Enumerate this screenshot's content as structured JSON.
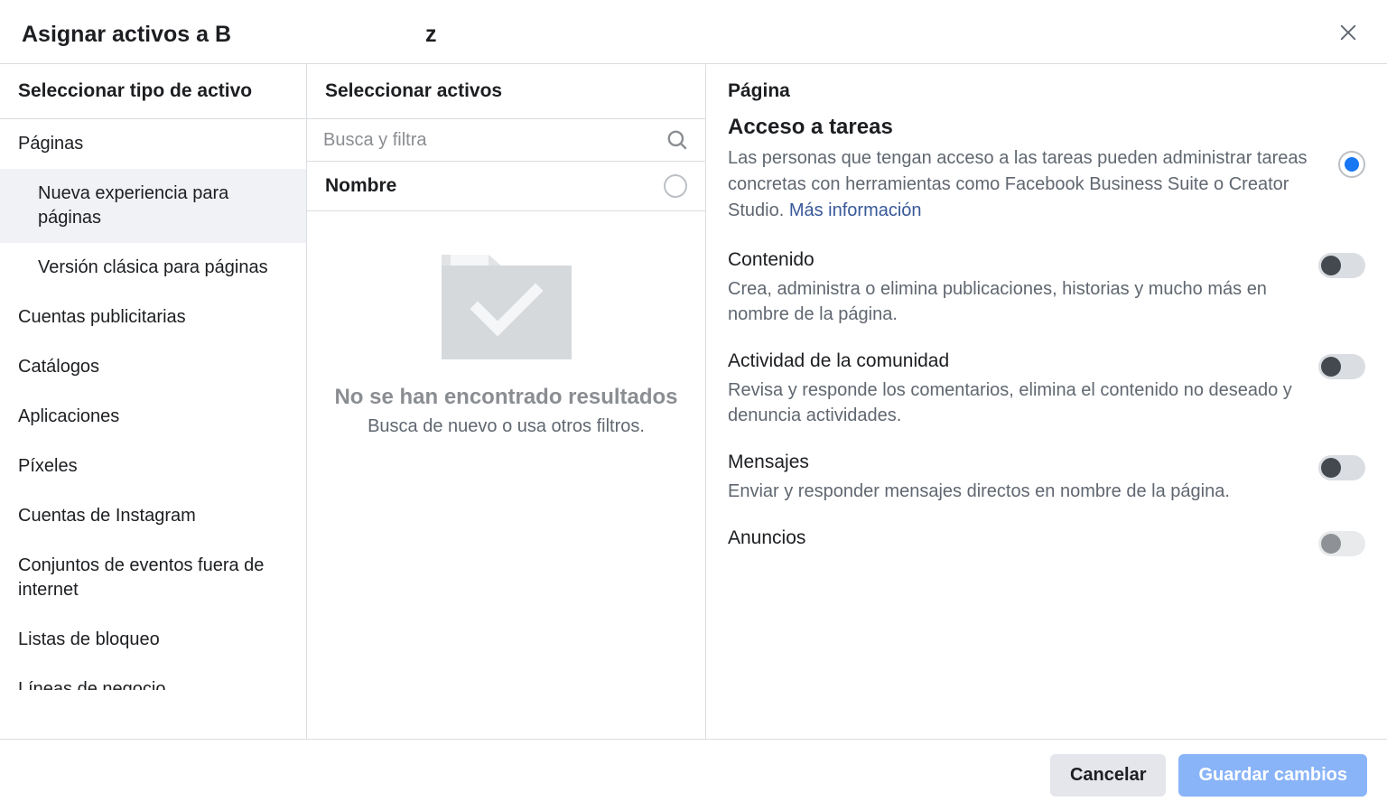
{
  "header": {
    "title_left": "Asignar activos a B",
    "title_right": "z"
  },
  "col1": {
    "header": "Seleccionar tipo de activo",
    "items": [
      {
        "label": "Páginas"
      },
      {
        "label": "Nueva experiencia para páginas",
        "sub": true,
        "selected": true
      },
      {
        "label": "Versión clásica para páginas",
        "sub": true
      },
      {
        "label": "Cuentas publicitarias"
      },
      {
        "label": "Catálogos"
      },
      {
        "label": "Aplicaciones"
      },
      {
        "label": "Píxeles"
      },
      {
        "label": "Cuentas de Instagram"
      },
      {
        "label": "Conjuntos de eventos fuera de internet"
      },
      {
        "label": "Listas de bloqueo"
      },
      {
        "label": "Líneas de negocio",
        "cutoff": true
      }
    ]
  },
  "col2": {
    "header": "Seleccionar activos",
    "search_placeholder": "Busca y filtra",
    "name_label": "Nombre",
    "empty_title": "No se han encontrado resultados",
    "empty_sub": "Busca de nuevo o usa otros filtros."
  },
  "col3": {
    "title": "Página",
    "access": {
      "heading": "Acceso a tareas",
      "desc": "Las personas que tengan acceso a las tareas pueden administrar tareas concretas con herramientas como Facebook Business Suite o Creator Studio. ",
      "link": "Más información"
    },
    "tasks": [
      {
        "heading": "Contenido",
        "desc": "Crea, administra o elimina publicaciones, historias y mucho más en nombre de la página."
      },
      {
        "heading": "Actividad de la comunidad",
        "desc": "Revisa y responde los comentarios, elimina el contenido no deseado y denuncia actividades."
      },
      {
        "heading": "Mensajes",
        "desc": "Enviar y responder mensajes directos en nombre de la página."
      },
      {
        "heading": "Anuncios",
        "desc": ""
      }
    ]
  },
  "footer": {
    "cancel": "Cancelar",
    "save": "Guardar cambios"
  }
}
